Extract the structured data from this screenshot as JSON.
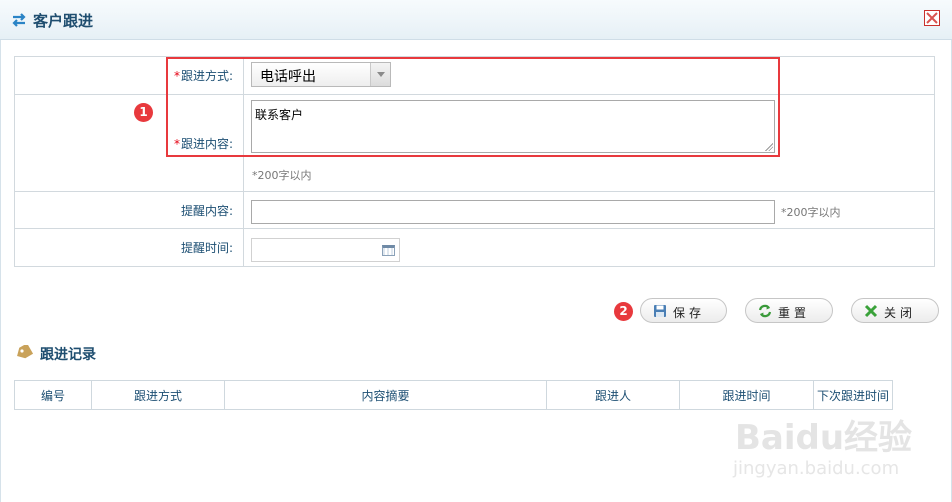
{
  "dialog": {
    "title": "客户跟进"
  },
  "form": {
    "method_label": "跟进方式:",
    "method_value": "电话呼出",
    "content_label": "跟进内容:",
    "content_value": "联系客户",
    "content_hint": "*200字以内",
    "reminder_label": "提醒内容:",
    "reminder_hint": "*200字以内",
    "remind_time_label": "提醒时间:",
    "required_mark": "*"
  },
  "buttons": {
    "save": "保存",
    "reset": "重置",
    "close": "关闭"
  },
  "badges": {
    "one": "1",
    "two": "2"
  },
  "records": {
    "title": "跟进记录",
    "columns": [
      "编号",
      "跟进方式",
      "内容摘要",
      "跟进人",
      "跟进时间",
      "下次跟进时间"
    ]
  },
  "watermark": {
    "brand": "Baidu经验",
    "url": "jingyan.baidu.com"
  },
  "colors": {
    "accent": "#1f4e70",
    "annotation": "#e8393d",
    "required": "#e60012"
  }
}
